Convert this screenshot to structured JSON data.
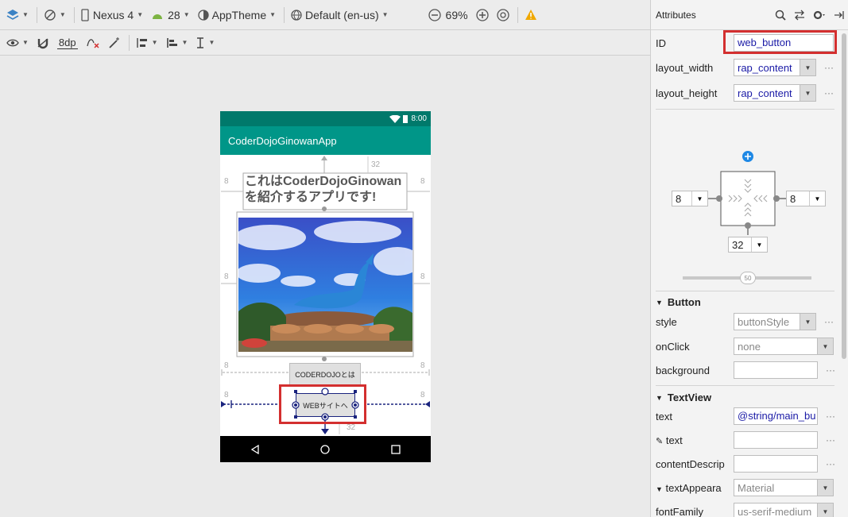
{
  "toolbar": {
    "device": "Nexus 4",
    "api": "28",
    "theme": "AppTheme",
    "locale": "Default (en-us)",
    "zoom": "69%",
    "margin": "8dp"
  },
  "attributes": {
    "title": "Attributes",
    "id_label": "ID",
    "id_value": "web_button",
    "layout_width_label": "layout_width",
    "layout_width_value": "rap_content",
    "layout_height_label": "layout_height",
    "layout_height_value": "rap_content",
    "constraints": {
      "left": "8",
      "right": "8",
      "bottom": "32",
      "bias": "50"
    },
    "button_section": "Button",
    "style_label": "style",
    "style_value": "buttonStyle",
    "onclick_label": "onClick",
    "onclick_value": "none",
    "background_label": "background",
    "background_value": "",
    "textview_section": "TextView",
    "text_label": "text",
    "text_value": "@string/main_bu",
    "tools_text_label": "text",
    "tools_text_value": "",
    "contentdesc_label": "contentDescrip",
    "contentdesc_value": "",
    "textappear_label": "textAppeara",
    "textappear_value": "Material",
    "fontfamily_label": "fontFamily",
    "fontfamily_value": "us-serif-medium"
  },
  "phone": {
    "time": "8:00",
    "app_title": "CoderDojoGinowanApp",
    "text_line1": "これはCoderDojoGinowan",
    "text_line2": "を紹介するアプリです!",
    "button1": "CODERDOJOとは",
    "button2": "WEBサイトへ",
    "margin_top": "32",
    "margin_bottom": "32",
    "side_margin": "8"
  },
  "colors": {
    "accent": "#009688",
    "status_bar": "#00796b",
    "highlight": "#d32f2f",
    "constraint": "#1a237e"
  }
}
